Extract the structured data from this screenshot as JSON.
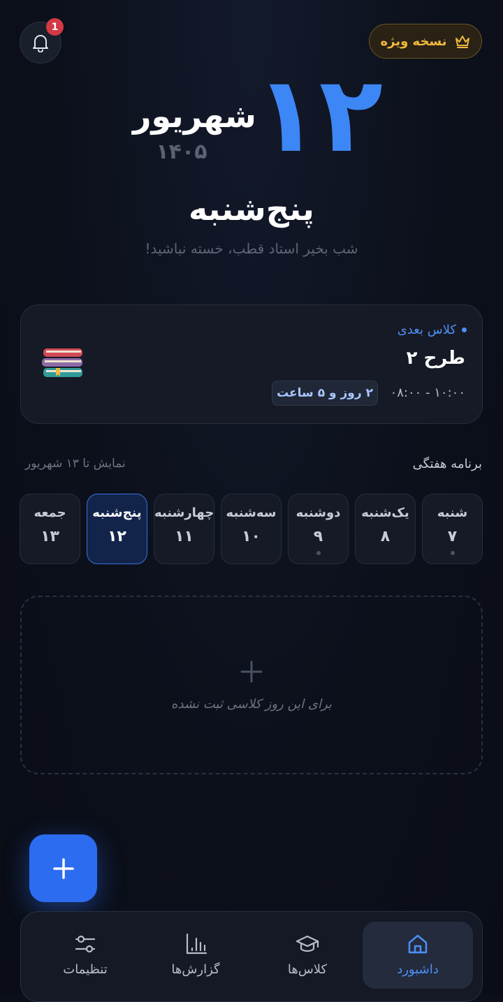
{
  "header": {
    "premium_label": "نسخه ویژه",
    "notification_count": "1"
  },
  "date": {
    "day": "۱۲",
    "month": "شهریور",
    "year": "۱۴۰۵",
    "weekday": "پنج‌شنبه",
    "greeting": "شب بخیر استاد قطب، خسته نباشید!"
  },
  "next_class": {
    "label": "کلاس بعدی",
    "name": "طرح ۲",
    "time": "۰۸:۰۰ - ۱۰:۰۰",
    "countdown": "۲ روز و ۵ ساعت"
  },
  "weekly": {
    "title": "برنامه هفتگی",
    "range": "نمایش تا ۱۳ شهریور",
    "days": [
      {
        "name": "شنبه",
        "date": "۷"
      },
      {
        "name": "یک‌شنبه",
        "date": "۸"
      },
      {
        "name": "دوشنبه",
        "date": "۹"
      },
      {
        "name": "سه‌شنبه",
        "date": "۱۰"
      },
      {
        "name": "چهارشنبه",
        "date": "۱۱"
      },
      {
        "name": "پنج‌شنبه",
        "date": "۱۲"
      },
      {
        "name": "جمعه",
        "date": "۱۳"
      }
    ]
  },
  "empty_state": {
    "text": "برای این روز کلاسی ثبت نشده"
  },
  "nav": {
    "dashboard": "داشبورد",
    "classes": "کلاس‌ها",
    "reports": "گزارش‌ها",
    "settings": "تنظیمات"
  },
  "colors": {
    "accent": "#3d86f5",
    "premium": "#f0b93e",
    "badge": "#d33a45"
  },
  "icons": {
    "premium": "crown-icon",
    "notifications": "bell-icon",
    "fab": "plus-icon",
    "dashboard": "home-icon",
    "classes": "graduation-cap-icon",
    "reports": "bar-chart-icon",
    "settings": "sliders-icon"
  }
}
